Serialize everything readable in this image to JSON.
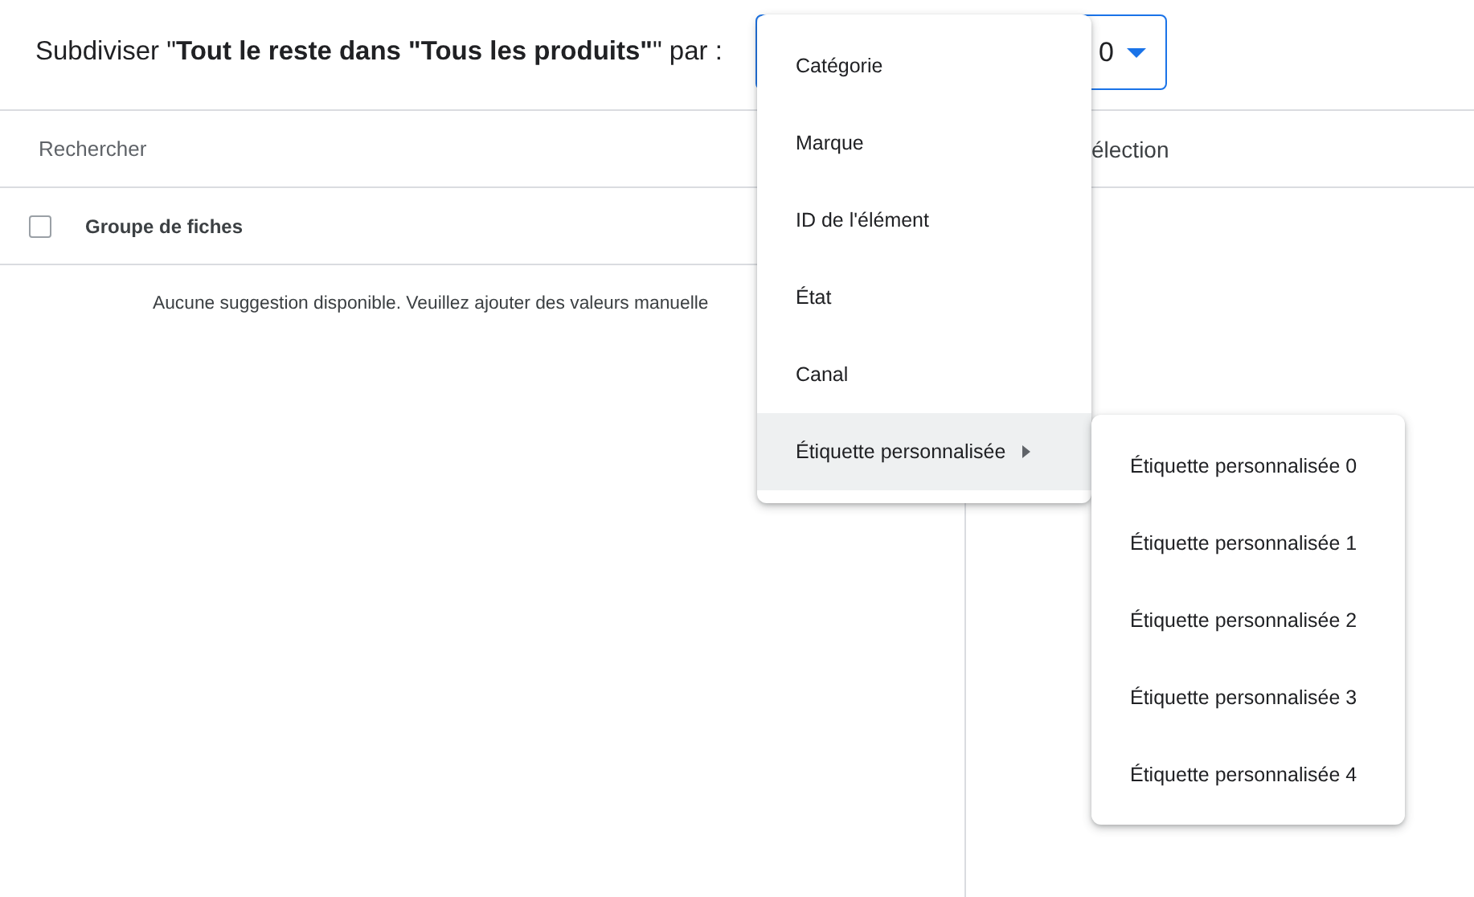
{
  "header": {
    "title": "Subdiviser \"**Tout le reste dans \"Tous les produits\"**\" par :",
    "dropdown_value": "0"
  },
  "left_pane": {
    "search": {
      "placeholder": "Rechercher"
    },
    "column_header": {
      "label": "Groupe de fiches",
      "checked": false
    },
    "empty_message": "Aucune suggestion disponible. Veuillez ajouter des valeurs manuelle"
  },
  "right_pane": {
    "heading": "élection"
  },
  "menu": {
    "items": [
      {
        "label": "Catégorie",
        "selected": false,
        "has_submenu": false
      },
      {
        "label": "Marque",
        "selected": false,
        "has_submenu": false
      },
      {
        "label": "ID de l'élément",
        "selected": false,
        "has_submenu": false
      },
      {
        "label": "État",
        "selected": false,
        "has_submenu": false
      },
      {
        "label": "Canal",
        "selected": false,
        "has_submenu": false
      },
      {
        "label": "Étiquette personnalisée",
        "selected": true,
        "has_submenu": true
      }
    ]
  },
  "submenu": {
    "items": [
      {
        "label": "Étiquette personnalisée 0",
        "selected": false
      },
      {
        "label": "Étiquette personnalisée 1",
        "selected": false
      },
      {
        "label": "Étiquette personnalisée 2",
        "selected": false
      },
      {
        "label": "Étiquette personnalisée 3",
        "selected": false
      },
      {
        "label": "Étiquette personnalisée 4",
        "selected": false
      }
    ]
  }
}
